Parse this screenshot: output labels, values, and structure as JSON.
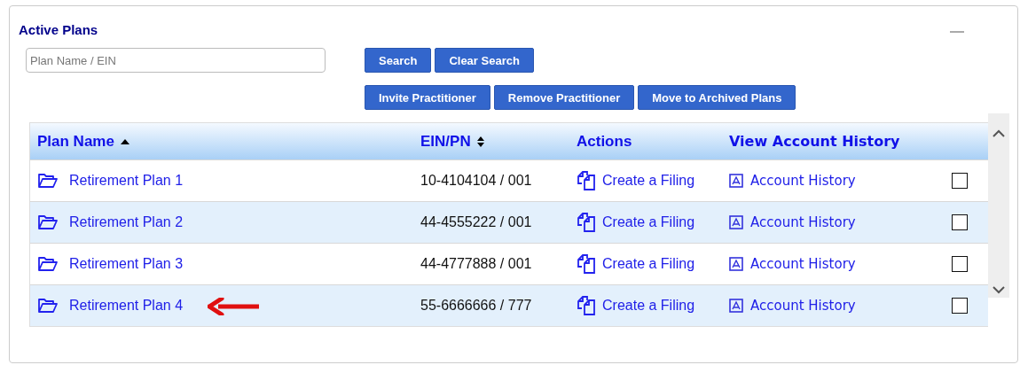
{
  "panel": {
    "title": "Active Plans"
  },
  "search": {
    "placeholder": "Plan Name / EIN"
  },
  "buttons_row_1": [
    "Search",
    "Clear Search"
  ],
  "buttons_row_2": [
    "Invite Practitioner",
    "Remove Practitioner",
    "Move to Archived Plans"
  ],
  "table": {
    "columns": [
      {
        "label": "Plan Name",
        "sortable": true,
        "sorted": true
      },
      {
        "label": "EIN/PN",
        "sortable": true,
        "sorted": false
      },
      {
        "label": "Actions",
        "sortable": false
      },
      {
        "label": "View Account History",
        "sortable": false
      }
    ],
    "rows": [
      {
        "plan_name": "Retirement Plan 1",
        "ein_pn": "10-4104104 / 001",
        "action": "Create a Filing",
        "history": "Account History",
        "checked": false,
        "arrow": false
      },
      {
        "plan_name": "Retirement Plan 2",
        "ein_pn": "44-4555222 / 001",
        "action": "Create a Filing",
        "history": "Account History",
        "checked": false,
        "arrow": false
      },
      {
        "plan_name": "Retirement Plan 3",
        "ein_pn": "44-4777888 / 001",
        "action": "Create a Filing",
        "history": "Account History",
        "checked": false,
        "arrow": false
      },
      {
        "plan_name": "Retirement Plan 4",
        "ein_pn": "55-6666666 / 777",
        "action": "Create a Filing",
        "history": "Account History",
        "checked": false,
        "arrow": true
      }
    ]
  }
}
